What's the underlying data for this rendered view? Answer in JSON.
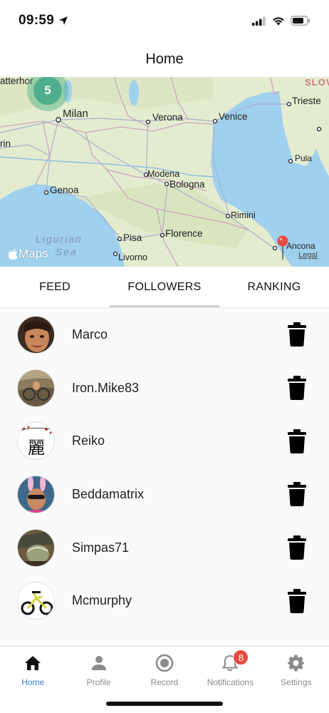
{
  "status_bar": {
    "time": "09:59"
  },
  "header": {
    "title": "Home"
  },
  "map": {
    "cluster_count": "5",
    "cities": {
      "milan": "Milan",
      "verona": "Verona",
      "venice": "Venice",
      "trieste": "Trieste",
      "genoa": "Genoa",
      "modena": "Modena",
      "bologna": "Bologna",
      "rimini": "Rimini",
      "pisa": "Pisa",
      "florence": "Florence",
      "livorno": "Livorno",
      "ancona": "Ancona",
      "pula": "Pula",
      "rin": "rin",
      "atterhor": "atterhor"
    },
    "region_label": "SLOV",
    "sea_label_1": "Ligurian",
    "sea_label_2": "Sea",
    "attribution": "Maps",
    "legal": "Legal"
  },
  "tabs": [
    {
      "label": "FEED"
    },
    {
      "label": "FOLLOWERS"
    },
    {
      "label": "RANKING"
    }
  ],
  "followers": [
    {
      "name": "Marco"
    },
    {
      "name": "Iron.Mike83"
    },
    {
      "name": "Reiko",
      "avatar_glyph": "麗"
    },
    {
      "name": "Beddamatrix"
    },
    {
      "name": "Simpas71"
    },
    {
      "name": "Mcmurphy"
    }
  ],
  "bottom_nav": [
    {
      "label": "Home",
      "icon": "home-icon"
    },
    {
      "label": "Profile",
      "icon": "person-icon"
    },
    {
      "label": "Record",
      "icon": "record-icon"
    },
    {
      "label": "Notifications",
      "icon": "bell-icon",
      "badge": "8"
    },
    {
      "label": "Settings",
      "icon": "gear-icon"
    }
  ],
  "colors": {
    "active_tab_underline": "#cfcfcf",
    "nav_active": "#2f7fd6",
    "badge": "#e8493f",
    "cluster": "#4fae8b",
    "sea": "#9fd0ee"
  }
}
